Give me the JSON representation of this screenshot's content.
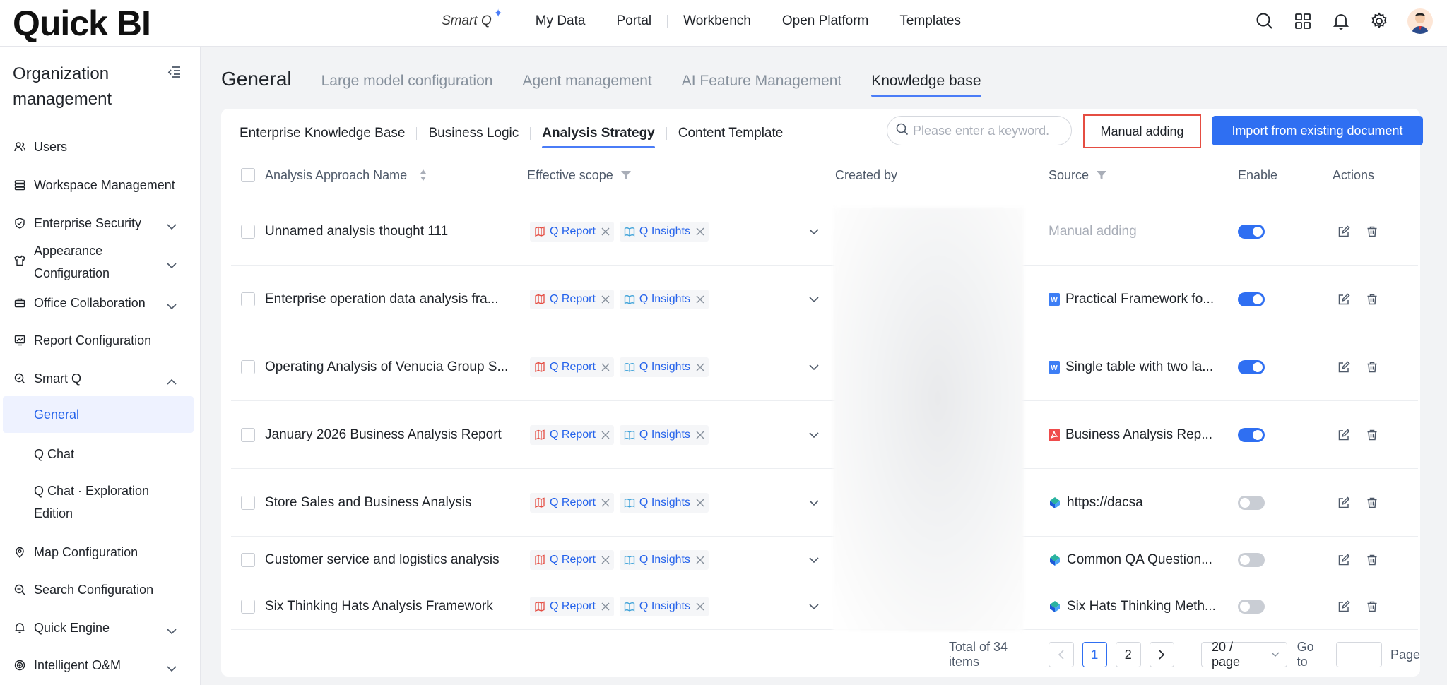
{
  "brand": {
    "logo": "Quick BI"
  },
  "topnav": {
    "smartq": "Smart Q",
    "items": [
      "My Data",
      "Portal",
      "Workbench",
      "Open Platform",
      "Templates"
    ]
  },
  "sidebar": {
    "title": "Organization management",
    "items": [
      {
        "label": "Users",
        "icon": "users-icon"
      },
      {
        "label": "Workspace Management",
        "icon": "workspace-icon"
      },
      {
        "label": "Enterprise Security",
        "icon": "shield-icon"
      },
      {
        "label": "Appearance Configuration",
        "icon": "shirt-icon"
      },
      {
        "label": "Office Collaboration",
        "icon": "briefcase-icon"
      },
      {
        "label": "Report Configuration",
        "icon": "report-icon"
      },
      {
        "label": "Smart Q",
        "icon": "smartq-icon"
      },
      {
        "label": "Map Configuration",
        "icon": "map-icon"
      },
      {
        "label": "Search Configuration",
        "icon": "search-config-icon"
      },
      {
        "label": "Quick Engine",
        "icon": "engine-icon"
      },
      {
        "label": "Intelligent O&M",
        "icon": "om-icon"
      }
    ],
    "smartq_sub": [
      "General",
      "Q Chat",
      "Q Chat · Exploration Edition"
    ]
  },
  "main_tabs": {
    "general": "General",
    "tabs": [
      "Large model configuration",
      "Agent management",
      "AI Feature Management",
      "Knowledge base"
    ],
    "active": "Knowledge base"
  },
  "subtabs": {
    "items": [
      "Enterprise Knowledge Base",
      "Business Logic",
      "Analysis Strategy",
      "Content Template"
    ],
    "active": "Analysis Strategy"
  },
  "toolbar": {
    "search_placeholder": "Please enter a keyword.",
    "manual_label": "Manual adding",
    "import_label": "Import from existing document"
  },
  "table": {
    "headers": {
      "name": "Analysis Approach Name",
      "scope": "Effective scope",
      "created_by": "Created by",
      "source": "Source",
      "enable": "Enable",
      "actions": "Actions"
    },
    "tag_labels": {
      "report": "Q Report",
      "insights": "Q Insights"
    },
    "rows": [
      {
        "name": "Unnamed analysis thought 111",
        "source": "Manual adding",
        "source_type": "manual",
        "enabled": true
      },
      {
        "name": "Enterprise operation data analysis fra...",
        "source": "Practical Framework fo...",
        "source_type": "word",
        "enabled": true
      },
      {
        "name": "Operating Analysis of Venucia Group S...",
        "source": "Single table with two la...",
        "source_type": "word",
        "enabled": true
      },
      {
        "name": "January 2026 Business Analysis Report",
        "source": "Business Analysis Rep...",
        "source_type": "pdf",
        "enabled": true
      },
      {
        "name": "Store Sales and Business Analysis",
        "source": "https://dacsa",
        "source_type": "web",
        "enabled": false
      },
      {
        "name": "Customer service and logistics analysis",
        "source": "Common QA Question...",
        "source_type": "web",
        "enabled": false
      },
      {
        "name": "Six Thinking Hats Analysis Framework",
        "source": "Six Hats Thinking Meth...",
        "source_type": "web",
        "enabled": false
      }
    ]
  },
  "pagination": {
    "total": "Total of 34 items",
    "pages": [
      "1",
      "2"
    ],
    "current": "1",
    "page_size": "20 / page",
    "goto": "Go to",
    "page_word": "Page"
  },
  "colors": {
    "accent": "#2f6ff2",
    "highlight_border": "#e54d42",
    "tag_text": "#2563eb"
  }
}
